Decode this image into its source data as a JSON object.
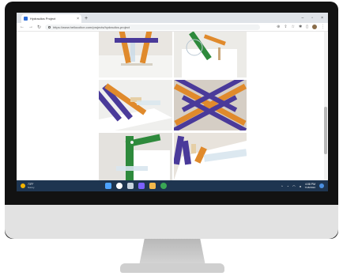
{
  "browser": {
    "tab_title": "Hydraulics Project",
    "tab_close": "×",
    "new_tab": "+",
    "url": "https://www.hellocolton.com/projects/hydraulics-project",
    "window_minimize": "–",
    "window_maximize": "▫",
    "window_close": "×"
  },
  "taskbar": {
    "weather_temp": "73°F",
    "weather_cond": "Sunny",
    "time": "4:08 PM",
    "date": "7/18/2022"
  },
  "colors": {
    "taskbar": "#1e3550",
    "purple_stick": "#4a3a9a",
    "orange_stick": "#e08a2c",
    "green_stick": "#2e8a3c"
  }
}
